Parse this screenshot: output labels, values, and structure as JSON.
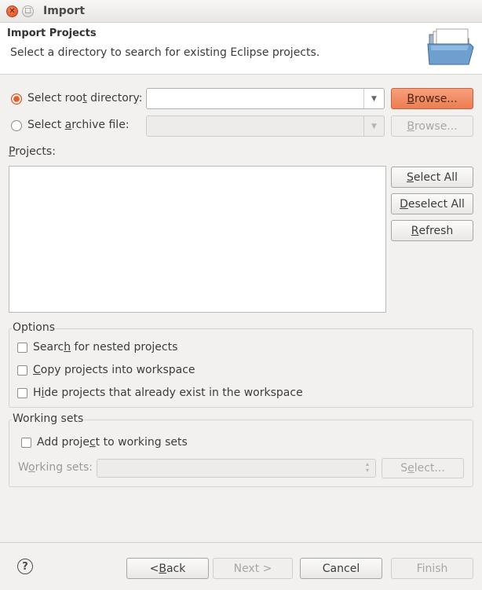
{
  "window": {
    "title": "Import"
  },
  "banner": {
    "title": "Import Projects",
    "description": "Select a directory to search for existing Eclipse projects."
  },
  "source": {
    "root": {
      "pre": "Select roo",
      "u": "t",
      "post": " directory:",
      "selected": true,
      "value": ""
    },
    "archive": {
      "pre": "Select ",
      "u": "a",
      "post": "rchive file:",
      "selected": false,
      "value": ""
    },
    "browse_root": {
      "pre": "",
      "u": "B",
      "post": "rowse..."
    },
    "browse_archive": {
      "pre": "",
      "u": "B",
      "post": "rowse..."
    }
  },
  "projects": {
    "label_u": "P",
    "label_rest": "rojects:",
    "items": [],
    "select_all": {
      "pre": "",
      "u": "S",
      "post": "elect All"
    },
    "deselect_all": {
      "pre": "",
      "u": "D",
      "post": "eselect All"
    },
    "refresh": {
      "pre": "",
      "u": "R",
      "post": "efresh"
    }
  },
  "options": {
    "title": "Options",
    "nested": {
      "pre": "Searc",
      "u": "h",
      "post": " for nested projects",
      "checked": false
    },
    "copy": {
      "pre": "",
      "u": "C",
      "post": "opy projects into workspace",
      "checked": false
    },
    "hide": {
      "pre": "H",
      "u": "i",
      "post": "de projects that already exist in the workspace",
      "checked": false
    }
  },
  "working_sets": {
    "title": "Working sets",
    "add": {
      "pre": "Add proje",
      "u": "c",
      "post": "t to working sets",
      "checked": false
    },
    "label": {
      "pre": "W",
      "u": "o",
      "post": "rking sets:"
    },
    "value": "",
    "select_button": {
      "pre": "S",
      "u": "e",
      "post": "lect..."
    }
  },
  "footer": {
    "help_symbol": "?",
    "back": {
      "pre": "< ",
      "u": "B",
      "post": "ack"
    },
    "next": "Next >",
    "cancel": "Cancel",
    "finish": "Finish"
  },
  "colors": {
    "accent": "#ec7d52",
    "close": "#df4a1a"
  },
  "icons": {
    "close": "close-icon",
    "maximize": "maximize-icon",
    "folder": "folder-icon",
    "help": "help-icon"
  }
}
